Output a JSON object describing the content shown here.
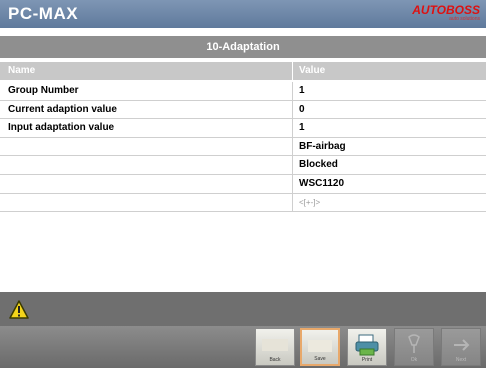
{
  "app": {
    "title": "PC-MAX",
    "logo_text": "AUTOBOSS",
    "logo_sub": "auto solutions"
  },
  "section": {
    "title": "10-Adaptation"
  },
  "table": {
    "columns": [
      "Name",
      "Value"
    ],
    "rows": [
      {
        "name": "Group Number",
        "value": "1"
      },
      {
        "name": "Current adaption value",
        "value": "0"
      },
      {
        "name": "Input adaptation value",
        "value": "1"
      },
      {
        "name": "",
        "value": "BF-airbag"
      },
      {
        "name": "",
        "value": "Blocked"
      },
      {
        "name": "",
        "value": "WSC1120"
      },
      {
        "name": "",
        "value": "<[+-]>"
      }
    ]
  },
  "status": {
    "icon": "warning-icon"
  },
  "toolbar": {
    "buttons": [
      {
        "label": "Back",
        "icon": "back-icon"
      },
      {
        "label": "Save",
        "icon": "save-icon"
      },
      {
        "label": "Print",
        "icon": "print-icon"
      },
      {
        "label": "Ok",
        "icon": "ok-icon"
      },
      {
        "label": "Next",
        "icon": "next-icon"
      }
    ]
  },
  "colors": {
    "titlebar": "#6b84a6",
    "logo_red": "#dd1111",
    "warning_yellow": "#f4d51b"
  }
}
